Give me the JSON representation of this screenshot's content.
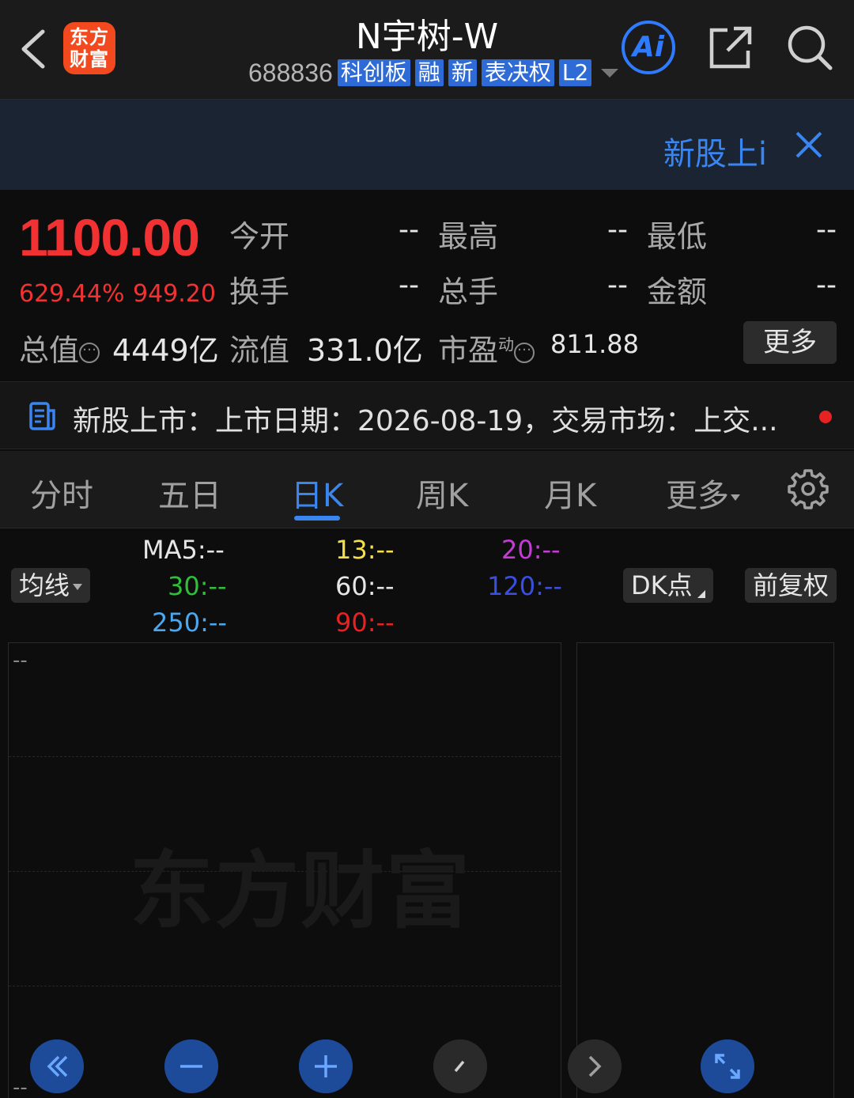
{
  "header": {
    "logo_line1": "东方",
    "logo_line2": "财富",
    "stock_name": "N宇树-W",
    "code": "688836",
    "tags": [
      "科创板",
      "融",
      "新",
      "表决权",
      "L2"
    ],
    "ai_label": "Ai"
  },
  "banner": {
    "text": "新股上i"
  },
  "quote": {
    "price": "1100.00",
    "change_pct": "629.44%",
    "change_amt": "949.20",
    "fields": [
      {
        "label": "今开",
        "value": "--"
      },
      {
        "label": "最高",
        "value": "--"
      },
      {
        "label": "最低",
        "value": "--"
      },
      {
        "label": "换手",
        "value": "--"
      },
      {
        "label": "总手",
        "value": "--"
      },
      {
        "label": "金额",
        "value": "--"
      }
    ],
    "total_value_label": "总值",
    "total_value": "4449亿",
    "float_value_label": "流值",
    "float_value": "331.0亿",
    "pe_label": "市盈",
    "pe_sup": "动",
    "pe_value": "811.88",
    "more_label": "更多"
  },
  "news": {
    "text": "新股上市：上市日期：2026-08-19，交易市场：上交..."
  },
  "tabs": {
    "items": [
      "分时",
      "五日",
      "日K",
      "周K",
      "月K",
      "更多"
    ],
    "active": "日K"
  },
  "indicators": {
    "ma_selector": "均线",
    "dk_label": "DK点",
    "adjust_label": "前复权",
    "ma": [
      {
        "label": "MA5:--",
        "color": "#e6e6e6"
      },
      {
        "label": "13:--",
        "color": "#f5e04a"
      },
      {
        "label": "20:--",
        "color": "#c63ad6"
      },
      {
        "label": "30:--",
        "color": "#2fbf3a"
      },
      {
        "label": "60:--",
        "color": "#e6e6e6"
      },
      {
        "label": "120:--",
        "color": "#3a4fe0"
      },
      {
        "label": "250:--",
        "color": "#4aa8f0"
      },
      {
        "label": "90:--",
        "color": "#e62222"
      }
    ]
  },
  "chart": {
    "top_value": "--",
    "bottom_value": "--",
    "watermark": "东方财富"
  },
  "colors": {
    "up": "#f23232",
    "accent": "#3a86f0",
    "tag": "#2e6bd6"
  }
}
